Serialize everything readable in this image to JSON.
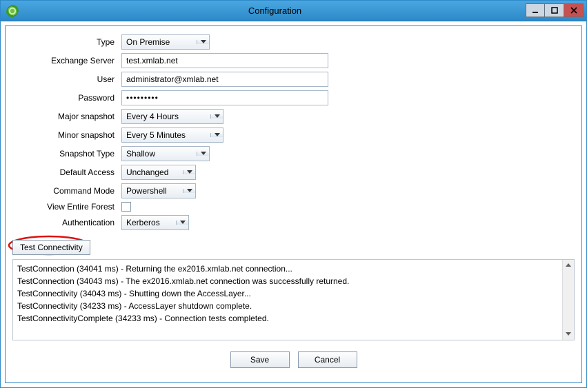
{
  "window": {
    "title": "Configuration"
  },
  "form": {
    "type_label": "Type",
    "type_value": "On Premise",
    "server_label": "Exchange Server",
    "server_value": "test.xmlab.net",
    "user_label": "User",
    "user_value": "administrator@xmlab.net",
    "password_label": "Password",
    "password_value": "•••••••••",
    "major_label": "Major snapshot",
    "major_value": "Every 4 Hours",
    "minor_label": "Minor snapshot",
    "minor_value": "Every 5 Minutes",
    "snap_type_label": "Snapshot Type",
    "snap_type_value": "Shallow",
    "default_access_label": "Default Access",
    "default_access_value": "Unchanged",
    "cmd_mode_label": "Command Mode",
    "cmd_mode_value": "Powershell",
    "forest_label": "View Entire Forest",
    "auth_label": "Authentication",
    "auth_value": "Kerberos"
  },
  "test_button_label": "Test Connectivity",
  "log": {
    "lines": [
      "TestConnection (34041 ms) - Returning the ex2016.xmlab.net connection...",
      "TestConnection (34043 ms) - The ex2016.xmlab.net connection was successfully returned.",
      "TestConnectivity (34043 ms) - Shutting down the AccessLayer...",
      "TestConnectivity (34233 ms) - AccessLayer shutdown complete.",
      "TestConnectivityComplete (34233 ms) - Connection tests completed."
    ]
  },
  "buttons": {
    "save": "Save",
    "cancel": "Cancel"
  }
}
